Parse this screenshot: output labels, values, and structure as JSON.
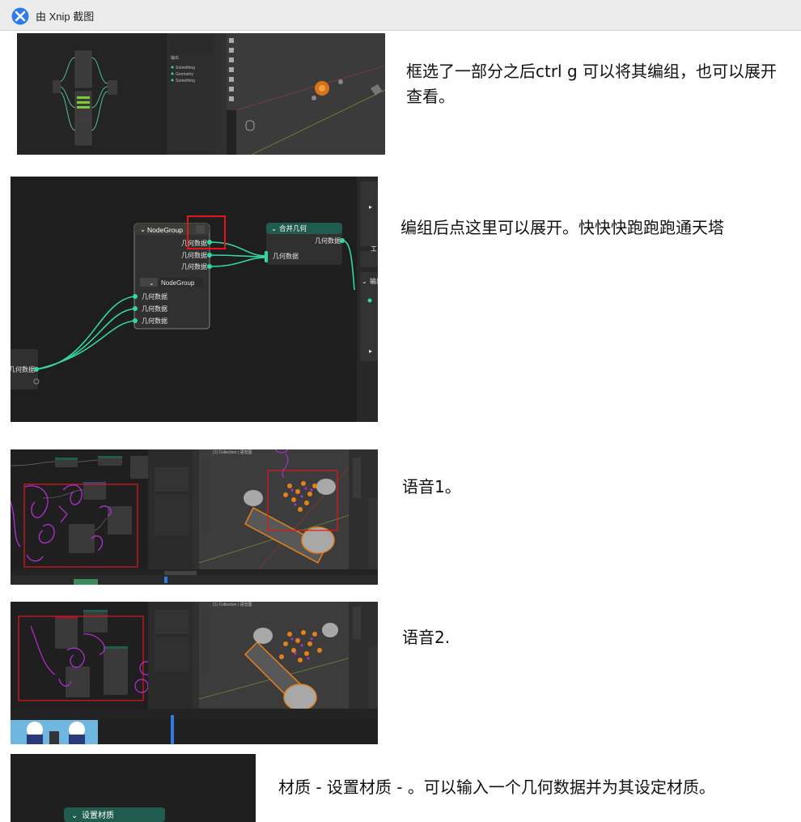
{
  "window": {
    "title": "由 Xnip 截图",
    "logo_icon": "xnip-logo-icon"
  },
  "notes": [
    {
      "text": "框选了一部分之后ctrl g 可以将其编组，也可以展开查看。"
    },
    {
      "text": "编组后点这里可以展开。快快快跑跑跑通天塔"
    },
    {
      "text": "语音1。"
    },
    {
      "text": "语音2."
    },
    {
      "text": "材质 - 设置材质 - 。可以输入一个几何数据并为其设定材质。"
    }
  ],
  "shot1": {
    "panel_items": [
      "Something",
      "Geometry",
      "Something"
    ],
    "panel_title": "输出"
  },
  "shot2": {
    "node_group_title": "NodeGroup",
    "join_title": "合并几何",
    "socket": "几何数据",
    "outputs": [
      "几何数据",
      "几何数据",
      "几何数据"
    ],
    "inputs": [
      "几何数据",
      "几何数据",
      "几何数据"
    ],
    "group_selector": "NodeGroup",
    "join_input": "几何数据",
    "join_output": "几何数据",
    "left_socket": "几何数据",
    "side_label": "输出",
    "side_char": "工"
  },
  "shot3": {
    "viewport_label": "(1) Collection | 语音图"
  },
  "shot4": {
    "viewport_label": "(1) Collection | 语音图"
  },
  "shot5": {
    "node_title": "设置材质"
  },
  "colors": {
    "node_green_header": "#1f5c4f",
    "socket_teal": "#35d6a4",
    "highlight_red": "#e0161a",
    "annotation_purple": "#b52fd8",
    "selection_orange": "#e6801a"
  }
}
